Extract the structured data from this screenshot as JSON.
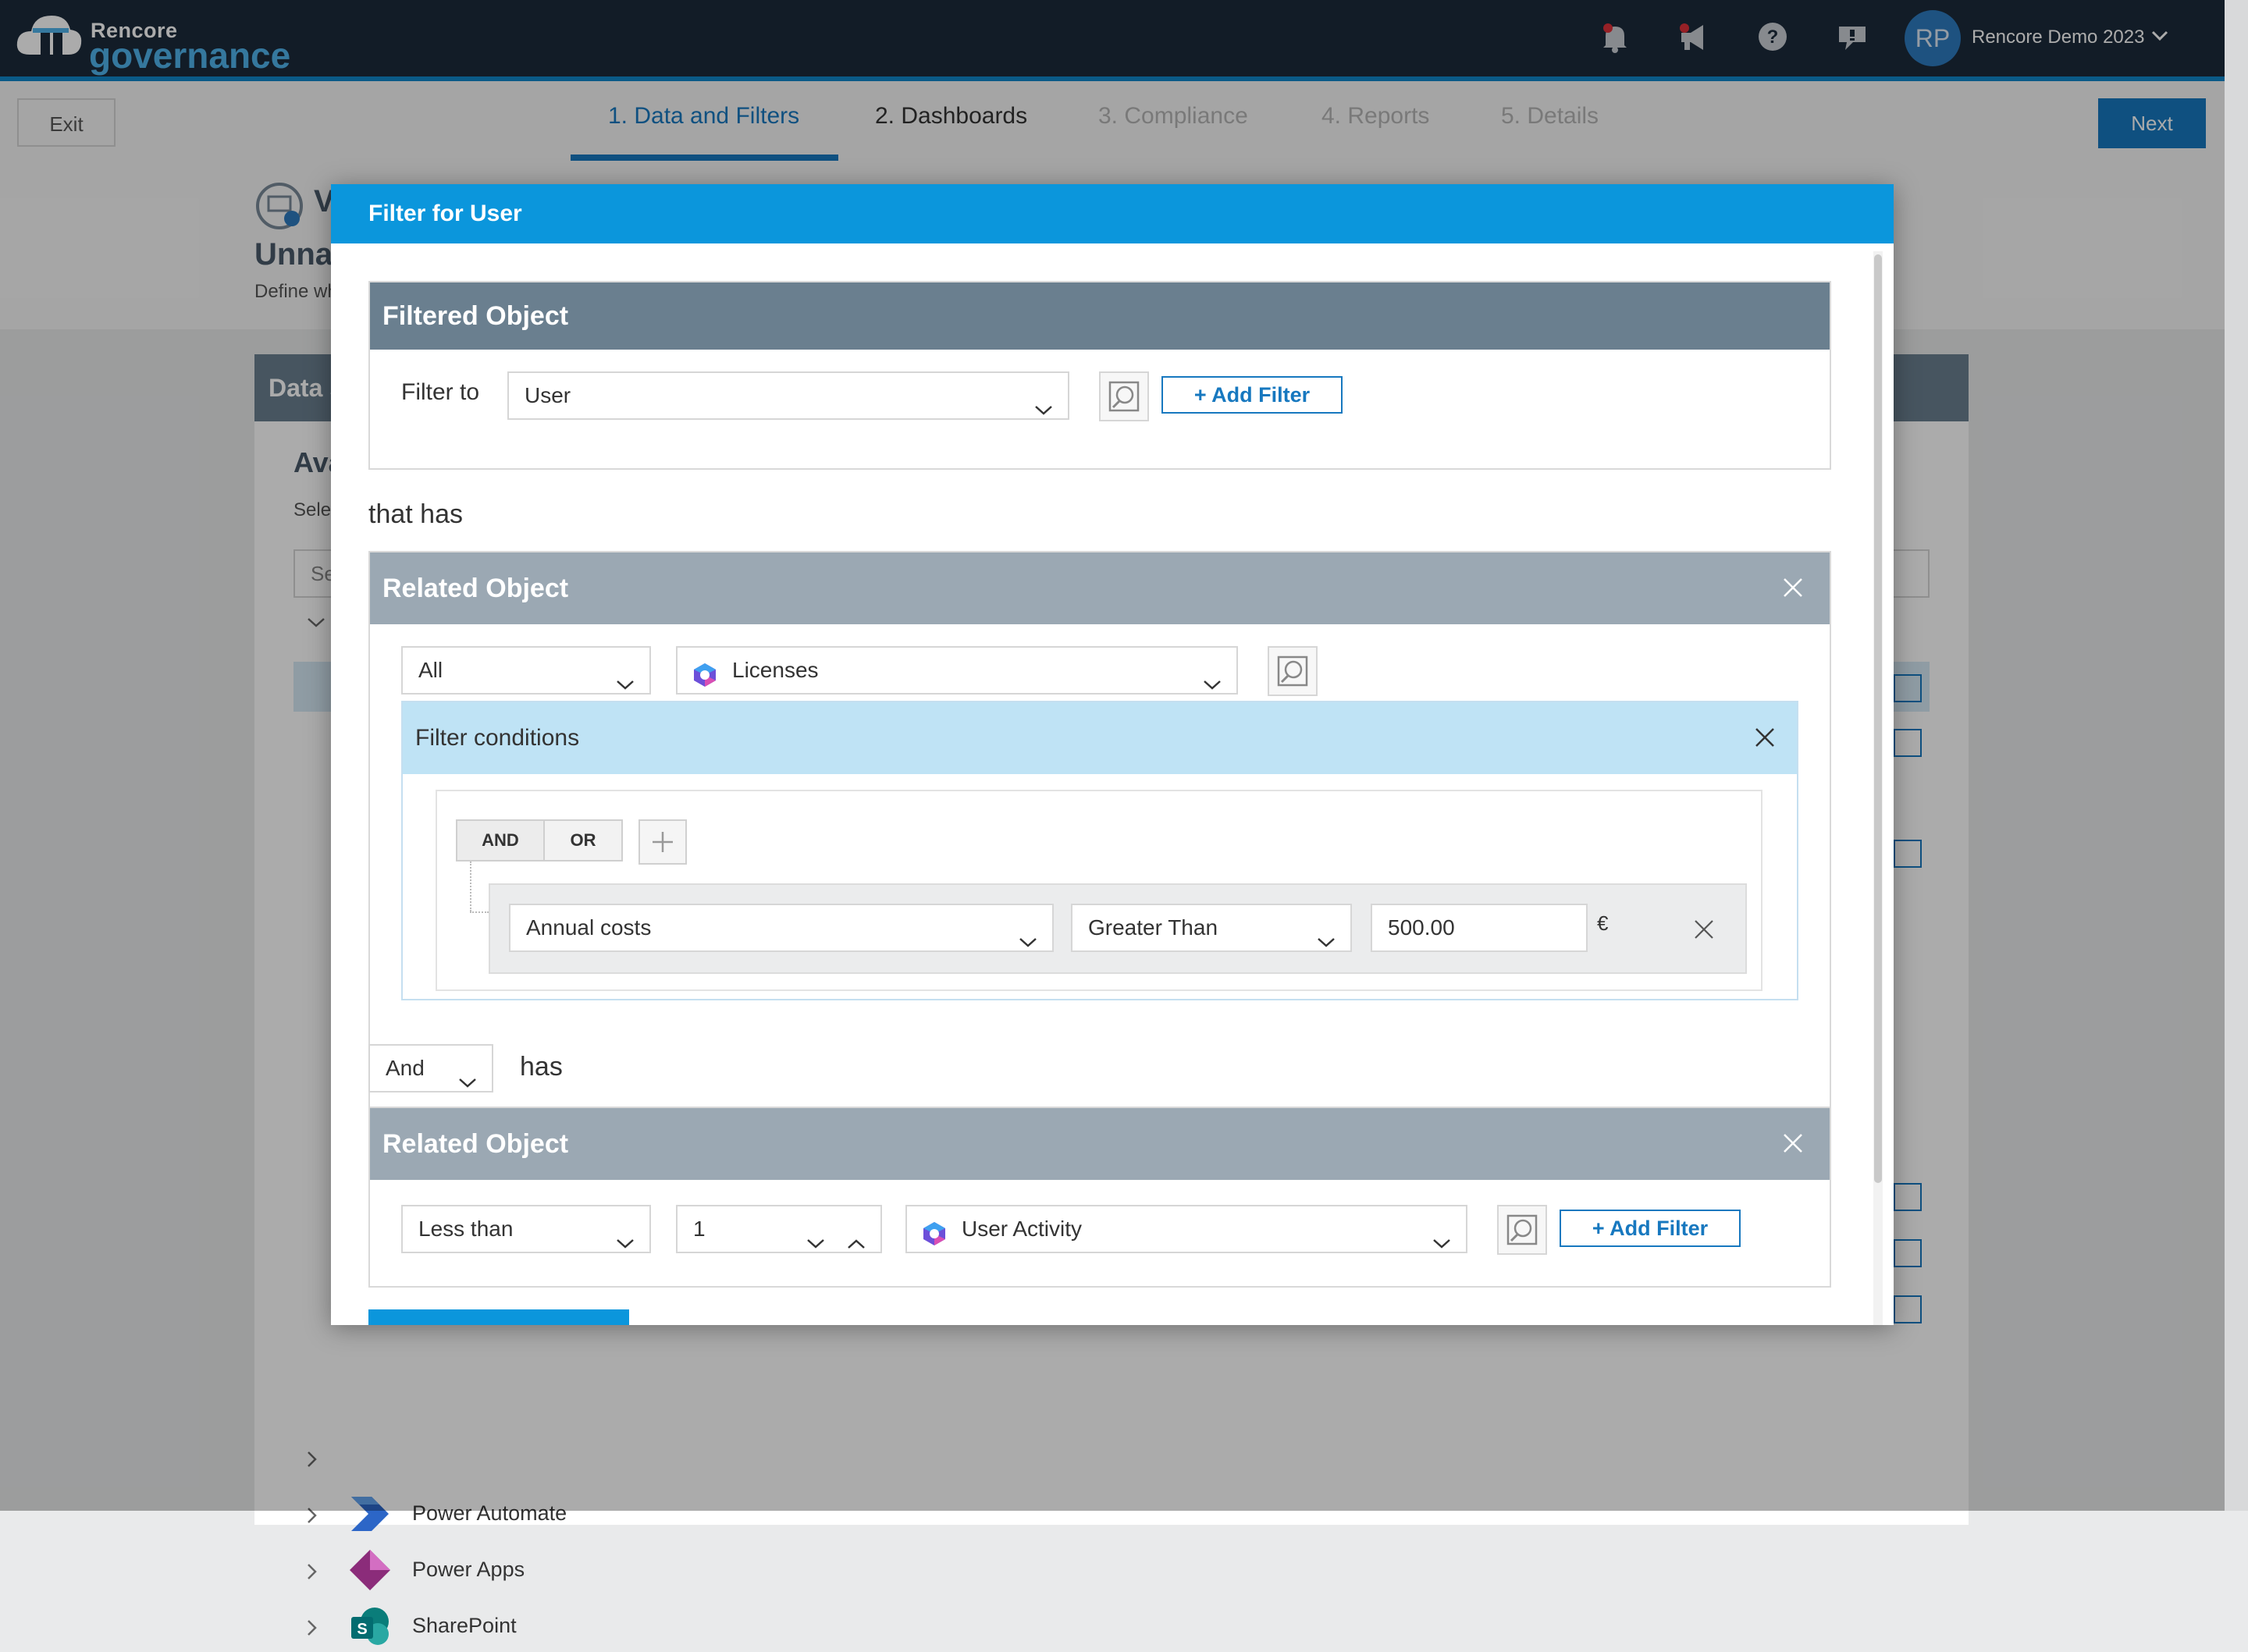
{
  "app": {
    "logo_top": "Rencore",
    "logo_bottom": "governance",
    "tenant_initials": "RP",
    "tenant_name": "Rencore Demo 2023"
  },
  "topbar_icons": [
    "notification-bell-icon",
    "announcement-megaphone-icon",
    "help-icon",
    "feedback-icon"
  ],
  "wizard": {
    "exit_label": "Exit",
    "next_label": "Next",
    "steps": [
      {
        "label": "1. Data and Filters",
        "state": "active"
      },
      {
        "label": "2. Dashboards",
        "state": "enabled"
      },
      {
        "label": "3. Compliance",
        "state": "disabled"
      },
      {
        "label": "4. Reports",
        "state": "disabled"
      },
      {
        "label": "5. Details",
        "state": "disabled"
      }
    ]
  },
  "background": {
    "title_visible": "Unna",
    "subtitle_visible": "Define wh",
    "panel_head_visible": "Data s",
    "available_visible": "Ava",
    "select_visible": "Sele",
    "search_visible": "Se",
    "tree_items": [
      {
        "label": "Power Automate",
        "icon": "power-automate-icon"
      },
      {
        "label": "Power Apps",
        "icon": "power-apps-icon"
      },
      {
        "label": "SharePoint",
        "icon": "sharepoint-icon"
      }
    ]
  },
  "modal": {
    "title": "Filter for User",
    "filtered_object": {
      "heading": "Filtered Object",
      "filter_to_label": "Filter to",
      "filter_to_value": "User",
      "add_filter_label": "+ Add Filter"
    },
    "that_has_label": "that has",
    "related_1": {
      "heading": "Related Object",
      "quantifier": "All",
      "object": "Licenses",
      "filter_conditions": {
        "heading": "Filter conditions",
        "and_label": "AND",
        "or_label": "OR",
        "condition": {
          "field": "Annual costs",
          "operator": "Greater Than",
          "value": "500.00",
          "unit": "€"
        }
      }
    },
    "joiner": {
      "value": "And",
      "has_label": "has"
    },
    "related_2": {
      "heading": "Related Object",
      "quantifier": "Less than",
      "count": "1",
      "object": "User Activity",
      "add_filter_label": "+ Add Filter"
    }
  }
}
